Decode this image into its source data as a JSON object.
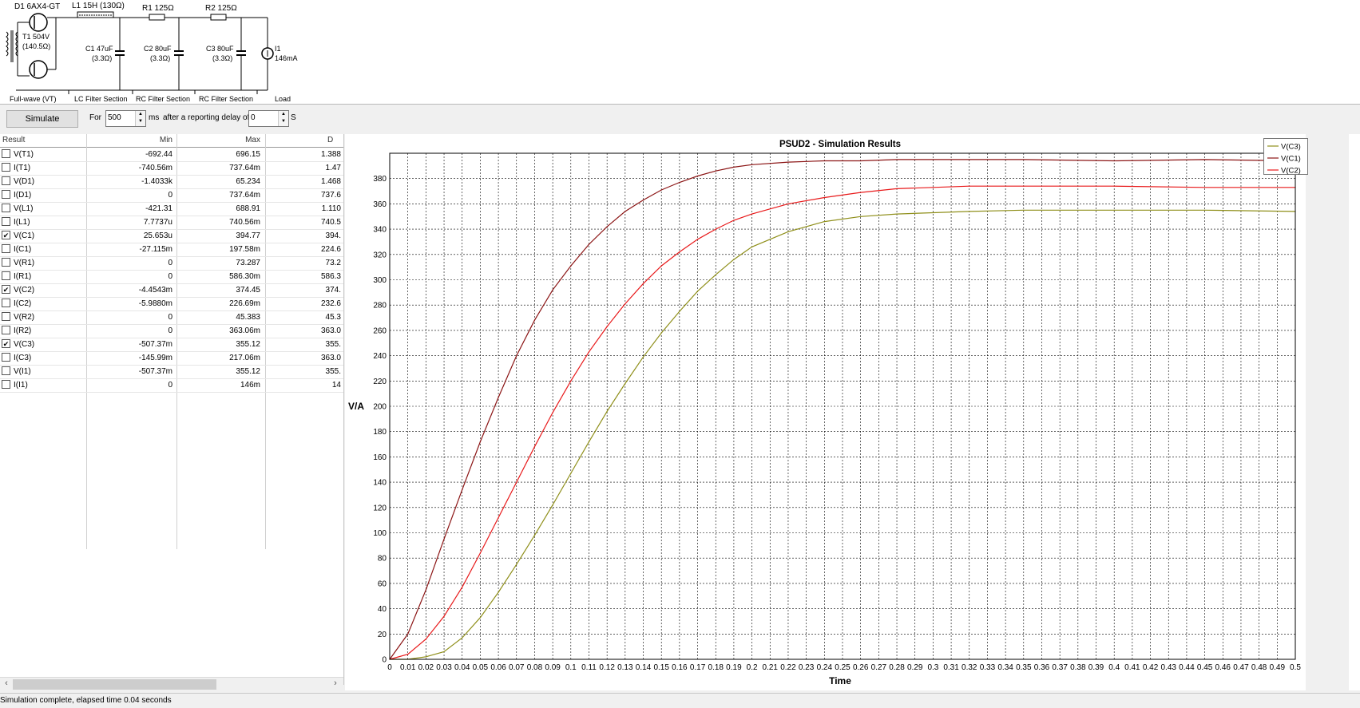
{
  "schematic": {
    "rectifier_label": "D1 6AX4-GT",
    "inductor_label": "L1 15H (130Ω)",
    "r1_label": "R1 125Ω",
    "r2_label": "R2 125Ω",
    "transformer_label_1": "T1 504V",
    "transformer_label_2": "(140.5Ω)",
    "c1_label_1": "C1 47uF",
    "c1_label_2": "(3.3Ω)",
    "c2_label_1": "C2 80uF",
    "c2_label_2": "(3.3Ω)",
    "c3_label_1": "C3 80uF",
    "c3_label_2": "(3.3Ω)",
    "load_label_1": "I1",
    "load_label_2": "146mA",
    "sections": [
      "Full-wave (VT)",
      "LC Filter Section",
      "RC Filter Section",
      "RC Filter Section",
      "Load"
    ]
  },
  "controls": {
    "simulate_label": "Simulate",
    "for_label": "For",
    "duration_value": "500",
    "ms_label": "ms",
    "delay_text": "after a reporting delay of",
    "delay_value": "0",
    "s_label": "S"
  },
  "results": {
    "headers": [
      "Result",
      "Min",
      "Max",
      "D"
    ],
    "rows": [
      {
        "name": "V(T1)",
        "min": "-692.44",
        "max": "696.15",
        "d": "1.388",
        "checked": false
      },
      {
        "name": "I(T1)",
        "min": "-740.56m",
        "max": "737.64m",
        "d": "1.47",
        "checked": false
      },
      {
        "name": "V(D1)",
        "min": "-1.4033k",
        "max": "65.234",
        "d": "1.468",
        "checked": false
      },
      {
        "name": "I(D1)",
        "min": "0",
        "max": "737.64m",
        "d": "737.6",
        "checked": false
      },
      {
        "name": "V(L1)",
        "min": "-421.31",
        "max": "688.91",
        "d": "1.110",
        "checked": false
      },
      {
        "name": "I(L1)",
        "min": "7.7737u",
        "max": "740.56m",
        "d": "740.5",
        "checked": false
      },
      {
        "name": "V(C1)",
        "min": "25.653u",
        "max": "394.77",
        "d": "394.",
        "checked": true
      },
      {
        "name": "I(C1)",
        "min": "-27.115m",
        "max": "197.58m",
        "d": "224.6",
        "checked": false
      },
      {
        "name": "V(R1)",
        "min": "0",
        "max": "73.287",
        "d": "73.2",
        "checked": false
      },
      {
        "name": "I(R1)",
        "min": "0",
        "max": "586.30m",
        "d": "586.3",
        "checked": false
      },
      {
        "name": "V(C2)",
        "min": "-4.4543m",
        "max": "374.45",
        "d": "374.",
        "checked": true
      },
      {
        "name": "I(C2)",
        "min": "-5.9880m",
        "max": "226.69m",
        "d": "232.6",
        "checked": false
      },
      {
        "name": "V(R2)",
        "min": "0",
        "max": "45.383",
        "d": "45.3",
        "checked": false
      },
      {
        "name": "I(R2)",
        "min": "0",
        "max": "363.06m",
        "d": "363.0",
        "checked": false
      },
      {
        "name": "V(C3)",
        "min": "-507.37m",
        "max": "355.12",
        "d": "355.",
        "checked": true
      },
      {
        "name": "I(C3)",
        "min": "-145.99m",
        "max": "217.06m",
        "d": "363.0",
        "checked": false
      },
      {
        "name": "V(I1)",
        "min": "-507.37m",
        "max": "355.12",
        "d": "355.",
        "checked": false
      },
      {
        "name": "I(I1)",
        "min": "0",
        "max": "146m",
        "d": "14",
        "checked": false
      }
    ]
  },
  "chart_data": {
    "type": "line",
    "title": "PSUD2 - Simulation Results",
    "xlabel": "Time",
    "ylabel": "V/A",
    "xlim": [
      0,
      0.5
    ],
    "ylim": [
      0,
      400
    ],
    "grid": true,
    "legend_position": "top-right",
    "xticks": [
      "0",
      "0.01",
      "0.02",
      "0.03",
      "0.04",
      "0.05",
      "0.06",
      "0.07",
      "0.08",
      "0.09",
      "0.1",
      "0.11",
      "0.12",
      "0.13",
      "0.14",
      "0.15",
      "0.16",
      "0.17",
      "0.18",
      "0.19",
      "0.2",
      "0.21",
      "0.22",
      "0.23",
      "0.24",
      "0.25",
      "0.26",
      "0.27",
      "0.28",
      "0.29",
      "0.3",
      "0.31",
      "0.32",
      "0.33",
      "0.34",
      "0.35",
      "0.36",
      "0.37",
      "0.38",
      "0.39",
      "0.4",
      "0.41",
      "0.42",
      "0.43",
      "0.44",
      "0.45",
      "0.46",
      "0.47",
      "0.48",
      "0.49",
      "0.5"
    ],
    "yticks": [
      "0",
      "20",
      "40",
      "60",
      "80",
      "100",
      "120",
      "140",
      "160",
      "180",
      "200",
      "220",
      "240",
      "260",
      "280",
      "300",
      "320",
      "340",
      "360",
      "380"
    ],
    "x": [
      0,
      0.01,
      0.02,
      0.03,
      0.04,
      0.05,
      0.06,
      0.07,
      0.08,
      0.09,
      0.1,
      0.11,
      0.12,
      0.13,
      0.14,
      0.15,
      0.16,
      0.17,
      0.18,
      0.19,
      0.2,
      0.22,
      0.24,
      0.26,
      0.28,
      0.3,
      0.32,
      0.35,
      0.4,
      0.45,
      0.5
    ],
    "series": [
      {
        "name": "V(C3)",
        "color": "#8f8f1a",
        "values": [
          0,
          0,
          2,
          6,
          17,
          33,
          53,
          75,
          98,
          122,
          147,
          172,
          196,
          218,
          239,
          258,
          275,
          291,
          304,
          316,
          326,
          338,
          346,
          350,
          352,
          353,
          354,
          355,
          355,
          355,
          354
        ]
      },
      {
        "name": "V(C1)",
        "color": "#8b1414",
        "values": [
          0,
          20,
          55,
          95,
          134,
          172,
          207,
          240,
          268,
          292,
          311,
          328,
          342,
          354,
          363,
          371,
          377,
          382,
          386,
          389,
          391,
          393,
          394,
          394,
          395,
          395,
          395,
          395,
          394,
          395,
          394
        ]
      },
      {
        "name": "V(C2)",
        "color": "#e8191a",
        "values": [
          0,
          4,
          16,
          34,
          57,
          84,
          112,
          140,
          168,
          195,
          220,
          243,
          263,
          281,
          297,
          311,
          322,
          332,
          340,
          347,
          352,
          360,
          365,
          369,
          372,
          373,
          374,
          374,
          374,
          373,
          373
        ]
      }
    ]
  },
  "status": {
    "text": "Simulation complete, elapsed time 0.04 seconds"
  }
}
